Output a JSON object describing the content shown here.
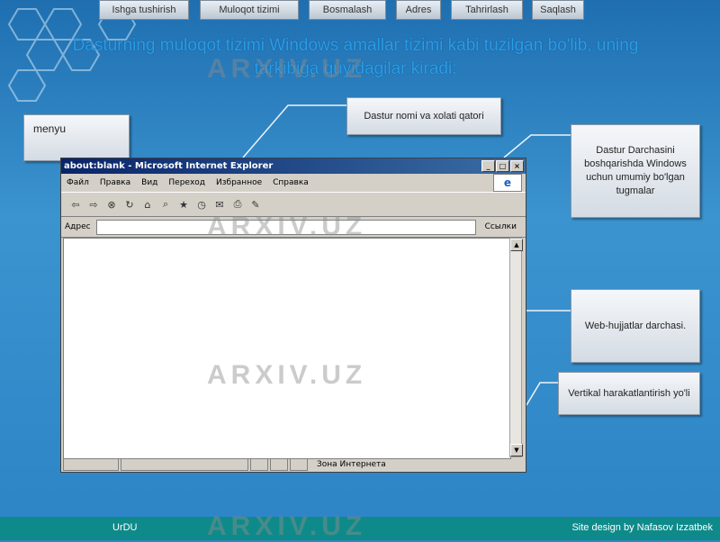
{
  "nav": [
    "Ishga tushirish",
    "Muloqot tizimi",
    "Bosmalash",
    "Adres",
    "Tahrirlash",
    "Saqlash"
  ],
  "title": "Dasturning muloqot tizimi Windows amallar tizimi kabi tuzilgan bo'lib, uning tarkibiga quyidagilar kiradi:",
  "callouts": {
    "menyu": "menyu",
    "title_bar": "Dastur nomi va xolati qatori",
    "window_buttons": "Dastur Darchasini boshqarishda Windows uchun umumiy bo'lgan tugmalar",
    "web_area": "Web-hujjatlar darchasi.",
    "scrollbar": "Vertikal harakatlantirish yo'li"
  },
  "ie": {
    "title": "about:blank - Microsoft Internet Explorer",
    "menu": [
      "Файл",
      "Правка",
      "Вид",
      "Переход",
      "Избранное",
      "Справка"
    ],
    "address_label": "Адрес",
    "links_label": "Ссылки",
    "status_text": "Зона Интернета"
  },
  "footer": {
    "left": "UrDU",
    "right": "Site design by Nafasov Izzatbek"
  },
  "watermark": "ARXIV.UZ"
}
